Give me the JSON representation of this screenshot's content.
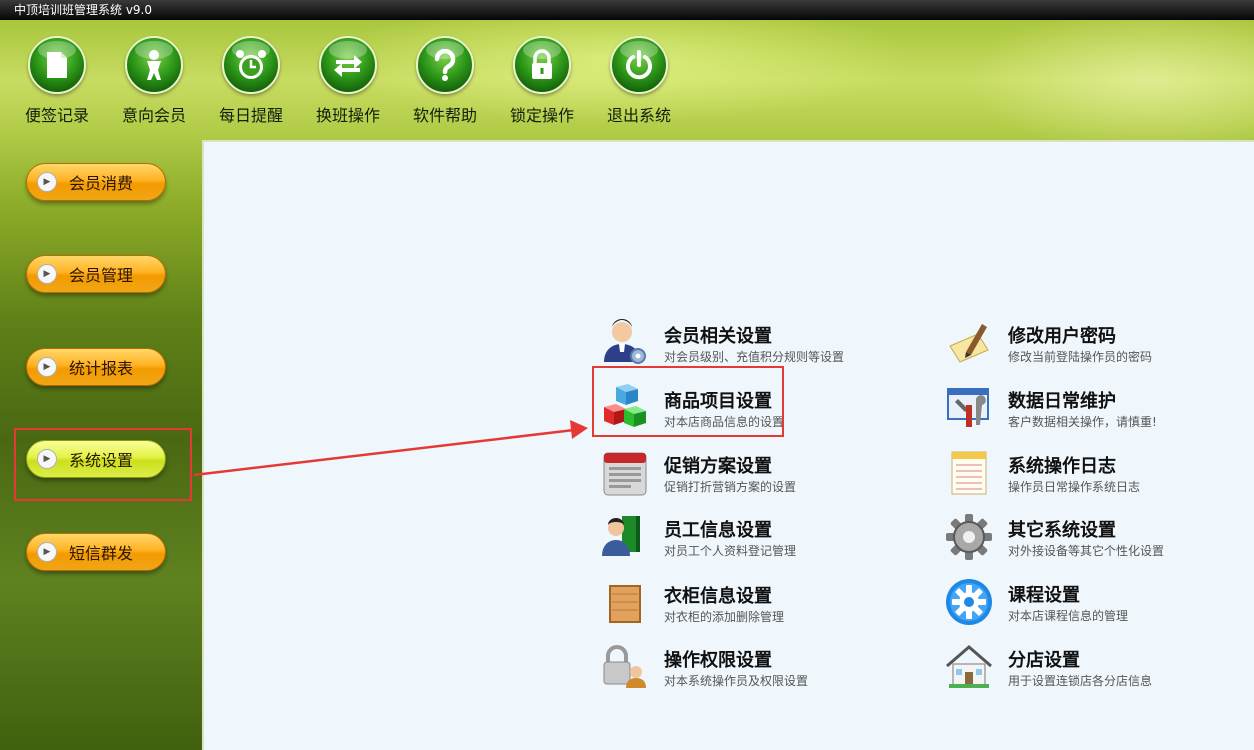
{
  "window": {
    "title": "中顶培训班管理系统  v9.0"
  },
  "toolbar": [
    {
      "label": "便签记录",
      "icon": "note-icon"
    },
    {
      "label": "意向会员",
      "icon": "person-icon"
    },
    {
      "label": "每日提醒",
      "icon": "alarm-clock-icon"
    },
    {
      "label": "换班操作",
      "icon": "swap-arrows-icon"
    },
    {
      "label": "软件帮助",
      "icon": "help-icon"
    },
    {
      "label": "锁定操作",
      "icon": "lock-icon"
    },
    {
      "label": "退出系统",
      "icon": "power-icon"
    }
  ],
  "sidebar": [
    {
      "label": "会员消费",
      "active": false
    },
    {
      "label": "会员管理",
      "active": false
    },
    {
      "label": "统计报表",
      "active": false
    },
    {
      "label": "系统设置",
      "active": true
    },
    {
      "label": "短信群发",
      "active": false
    }
  ],
  "settings": {
    "left": [
      {
        "title": "会员相关设置",
        "desc": "对会员级别、充值积分规则等设置",
        "icon": "member-gear-icon"
      },
      {
        "title": "商品项目设置",
        "desc": "对本店商品信息的设置",
        "icon": "cubes-icon"
      },
      {
        "title": "促销方案设置",
        "desc": "促销打折营销方案的设置",
        "icon": "calendar-icon"
      },
      {
        "title": "员工信息设置",
        "desc": "对员工个人资料登记管理",
        "icon": "employee-book-icon"
      },
      {
        "title": "衣柜信息设置",
        "desc": "对衣柜的添加删除管理",
        "icon": "wardrobe-icon"
      },
      {
        "title": "操作权限设置",
        "desc": "对本系统操作员及权限设置",
        "icon": "user-lock-icon"
      }
    ],
    "right": [
      {
        "title": "修改用户密码",
        "desc": "修改当前登陆操作员的密码",
        "icon": "pen-paper-icon"
      },
      {
        "title": "数据日常维护",
        "desc": "客户数据相关操作，请慎重!",
        "icon": "tools-window-icon"
      },
      {
        "title": "系统操作日志",
        "desc": "操作员日常操作系统日志",
        "icon": "notepad-icon"
      },
      {
        "title": "其它系统设置",
        "desc": "对外接设备等其它个性化设置",
        "icon": "gear-icon"
      },
      {
        "title": "课程设置",
        "desc": "对本店课程信息的管理",
        "icon": "blue-gear-icon"
      },
      {
        "title": "分店设置",
        "desc": "用于设置连锁店各分店信息",
        "icon": "house-icon"
      }
    ]
  },
  "colors": {
    "highlight": "#e53935",
    "panel": "#eff7fd",
    "nav_orange": "#ffb223",
    "nav_active": "#e3f247"
  }
}
